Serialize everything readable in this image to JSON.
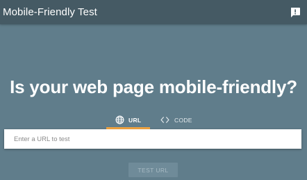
{
  "header": {
    "title": "Mobile-Friendly Test",
    "feedback_icon": "feedback-icon"
  },
  "main": {
    "headline": "Is your web page mobile-friendly?",
    "tabs": [
      {
        "label": "URL",
        "icon": "globe-icon",
        "selected": true
      },
      {
        "label": "CODE",
        "icon": "code-icon",
        "selected": false
      }
    ],
    "url_input": {
      "placeholder": "Enter a URL to test",
      "value": ""
    },
    "test_button": {
      "label": "TEST URL",
      "enabled": false
    }
  },
  "colors": {
    "background": "#607d8b",
    "header": "#455a64",
    "tab_indicator": "#f3a43f"
  }
}
